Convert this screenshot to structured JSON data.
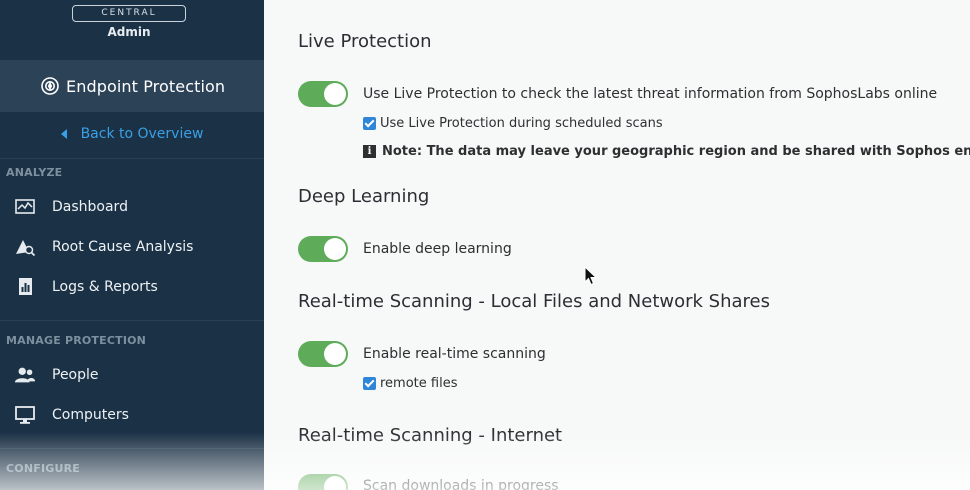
{
  "sidebar": {
    "central_label": "CENTRAL",
    "admin_label": "Admin",
    "product": {
      "label": "Endpoint Protection",
      "icon": "endpoint-shield-icon"
    },
    "back_link": "Back to Overview",
    "groups": [
      {
        "title": "ANALYZE",
        "items": [
          {
            "label": "Dashboard",
            "icon": "dashboard-icon"
          },
          {
            "label": "Root Cause Analysis",
            "icon": "root-cause-icon"
          },
          {
            "label": "Logs & Reports",
            "icon": "logs-reports-icon"
          }
        ]
      },
      {
        "title": "MANAGE PROTECTION",
        "items": [
          {
            "label": "People",
            "icon": "people-icon"
          },
          {
            "label": "Computers",
            "icon": "computer-icon"
          }
        ]
      },
      {
        "title": "CONFIGURE",
        "items": []
      }
    ]
  },
  "main": {
    "live_protection": {
      "title": "Live Protection",
      "toggle_label": "Use Live Protection to check the latest threat information from SophosLabs online",
      "toggle_on": true,
      "checkbox_label": "Use Live Protection during scheduled scans",
      "checkbox_checked": true,
      "note": "Note: The data may leave your geographic region and be shared with Sophos engineers.",
      "note_icon_glyph": "i"
    },
    "deep_learning": {
      "title": "Deep Learning",
      "toggle_label": "Enable deep learning",
      "toggle_on": true
    },
    "realtime_local": {
      "title": "Real-time Scanning - Local Files and Network Shares",
      "toggle_label": "Enable real-time scanning",
      "toggle_on": true,
      "checkbox_label": "remote files",
      "checkbox_checked": true
    },
    "realtime_internet": {
      "title": "Real-time Scanning - Internet",
      "toggle_label": "Scan downloads in progress",
      "toggle_on": true
    }
  },
  "colors": {
    "sidebar_bg": "#1b3145",
    "sidebar_highlight": "#2c4257",
    "link_blue": "#3aa0e6",
    "toggle_green": "#5eab5a",
    "checkbox_blue": "#2f86d9"
  }
}
